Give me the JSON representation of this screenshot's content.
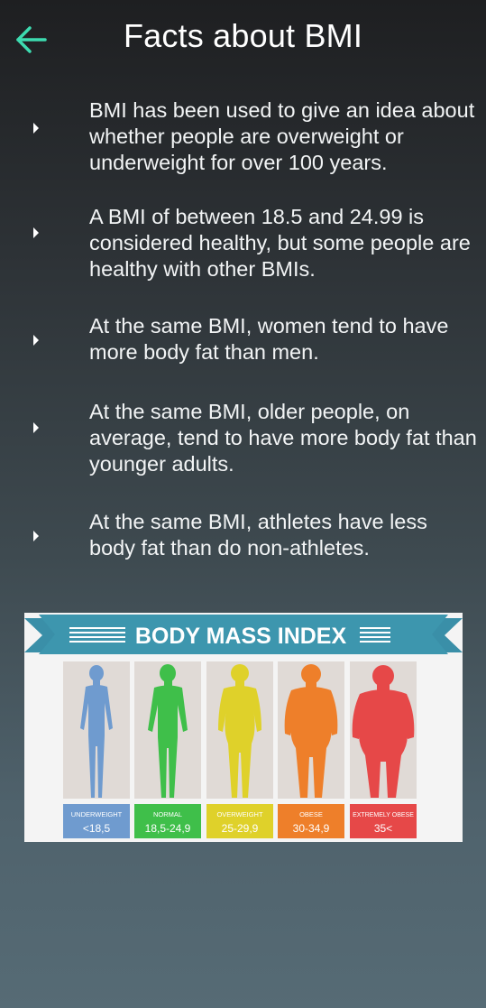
{
  "header": {
    "title": "Facts about BMI",
    "back_icon": "arrow-left-icon",
    "accent_color": "#3ddbb0"
  },
  "facts": [
    "BMI has been used to give an idea about whether people are overweight or underweight for over 100 years.",
    "A BMI of between 18.5 and 24.99 is considered healthy, but some people are healthy with other BMIs.",
    "At the same BMI, women tend to have more body fat than men.",
    "At the same BMI, older people, on average, tend to have more body fat than younger adults.",
    "At the same BMI, athletes have less body fat than do non-athletes."
  ],
  "bmi_image": {
    "banner": "BODY MASS INDEX",
    "categories": [
      {
        "label": "UNDERWEIGHT",
        "range": "<18,5",
        "color": "#6f9bcf"
      },
      {
        "label": "NORMAL",
        "range": "18,5-24,9",
        "color": "#3fbf4a"
      },
      {
        "label": "OVERWEIGHT",
        "range": "25-29,9",
        "color": "#dfd12a"
      },
      {
        "label": "OBESE",
        "range": "30-34,9",
        "color": "#ee7f2a"
      },
      {
        "label": "EXTREMELY OBESE",
        "range": "35<",
        "color": "#e64848"
      }
    ]
  }
}
